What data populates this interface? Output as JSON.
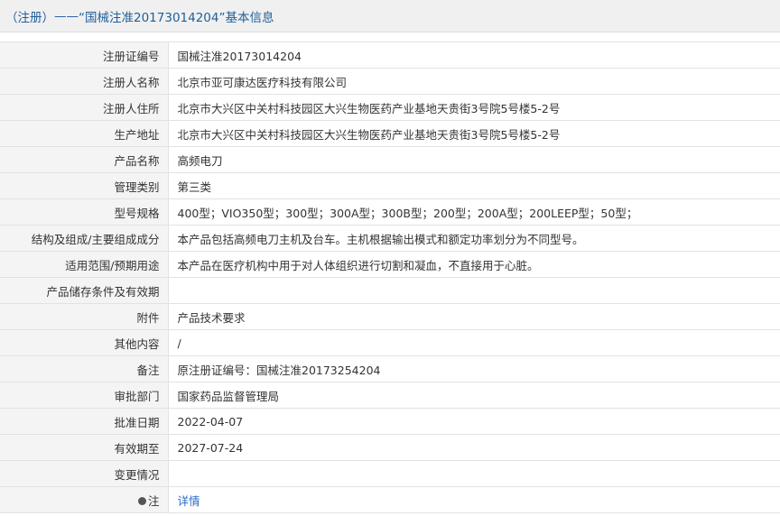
{
  "header": {
    "category": "（注册）",
    "separator": "——",
    "title": "“国械注准20173014204”基本信息"
  },
  "rows": [
    {
      "label": "注册证编号",
      "value": "国械注准20173014204"
    },
    {
      "label": "注册人名称",
      "value": "北京市亚可康达医疗科技有限公司"
    },
    {
      "label": "注册人住所",
      "value": "北京市大兴区中关村科技园区大兴生物医药产业基地天贵街3号院5号楼5-2号"
    },
    {
      "label": "生产地址",
      "value": "北京市大兴区中关村科技园区大兴生物医药产业基地天贵街3号院5号楼5-2号"
    },
    {
      "label": "产品名称",
      "value": "高频电刀"
    },
    {
      "label": "管理类别",
      "value": "第三类"
    },
    {
      "label": "型号规格",
      "value": "400型；VIO350型；300型；300A型；300B型；200型；200A型；200LEEP型；50型；"
    },
    {
      "label": "结构及组成/主要组成成分",
      "value": "本产品包括高频电刀主机及台车。主机根据输出模式和额定功率划分为不同型号。"
    },
    {
      "label": "适用范围/预期用途",
      "value": "本产品在医疗机构中用于对人体组织进行切割和凝血，不直接用于心脏。"
    },
    {
      "label": "产品储存条件及有效期",
      "value": ""
    },
    {
      "label": "附件",
      "value": "产品技术要求"
    },
    {
      "label": "其他内容",
      "value": "/"
    },
    {
      "label": "备注",
      "value": "原注册证编号：国械注准20173254204"
    },
    {
      "label": "审批部门",
      "value": "国家药品监督管理局"
    },
    {
      "label": "批准日期",
      "value": "2022-04-07"
    },
    {
      "label": "有效期至",
      "value": "2027-07-24"
    },
    {
      "label": "变更情况",
      "value": ""
    }
  ],
  "note": {
    "label": "注",
    "link_text": "详情",
    "icon": "info-bullet-icon"
  }
}
